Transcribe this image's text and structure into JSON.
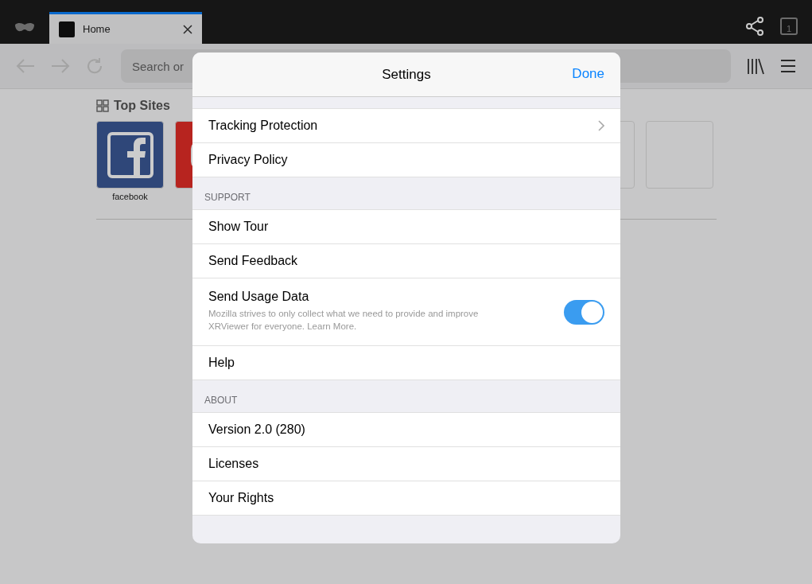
{
  "browser": {
    "tabs": [
      {
        "title": "Home",
        "selected": true
      }
    ],
    "tab_count": "1",
    "search": {
      "placeholder": "Search or"
    },
    "top_sites": {
      "title": "Top Sites",
      "tiles": [
        {
          "kind": "facebook",
          "label": "facebook"
        },
        {
          "kind": "video"
        },
        {
          "kind": "empty"
        },
        {
          "kind": "empty"
        }
      ]
    }
  },
  "settings": {
    "title": "Settings",
    "done": "Done",
    "sections": [
      {
        "rows": [
          {
            "kind": "link",
            "label": "Tracking Protection"
          },
          {
            "kind": "plain",
            "label": "Privacy Policy"
          }
        ]
      },
      {
        "header": "SUPPORT",
        "rows": [
          {
            "kind": "plain",
            "label": "Show Tour"
          },
          {
            "kind": "plain",
            "label": "Send Feedback"
          },
          {
            "kind": "toggle",
            "label": "Send Usage Data",
            "description": "Mozilla strives to only collect what we need to provide and improve XRViewer for everyone. Learn More.",
            "on": true
          },
          {
            "kind": "plain",
            "label": "Help"
          }
        ]
      },
      {
        "header": "ABOUT",
        "rows": [
          {
            "kind": "plain",
            "label": "Version 2.0 (280)"
          },
          {
            "kind": "plain",
            "label": "Licenses"
          },
          {
            "kind": "plain",
            "label": "Your Rights"
          }
        ]
      }
    ]
  }
}
